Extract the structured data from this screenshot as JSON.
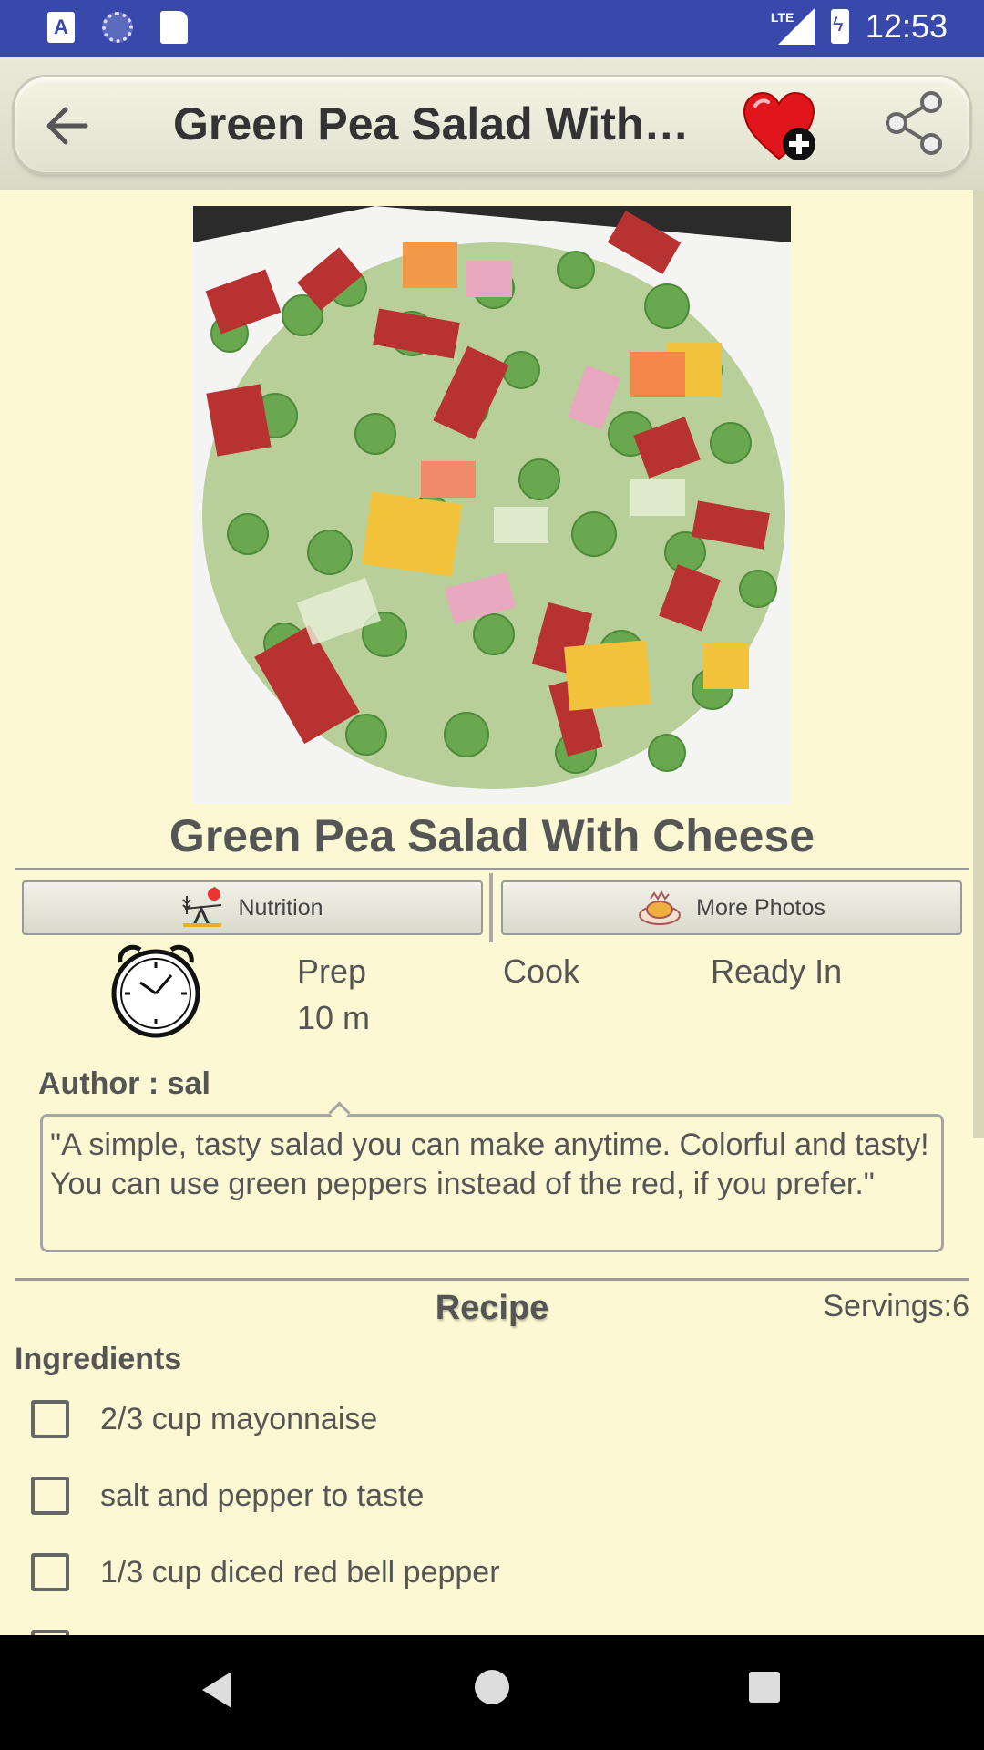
{
  "status_bar": {
    "left_icons": [
      "app-a-icon",
      "sync-icon",
      "sd-card-icon"
    ],
    "network": "LTE",
    "time": "12:53"
  },
  "toolbar": {
    "back_icon": "arrow-left-icon",
    "title": "Green Pea Salad With…",
    "favorite_icon": "heart-plus-icon",
    "share_icon": "share-icon"
  },
  "recipe": {
    "name": "Green Pea Salad With Cheese",
    "buttons": {
      "nutrition": "Nutrition",
      "more_photos": "More Photos"
    },
    "times": {
      "prep_label": "Prep",
      "prep_value": "10 m",
      "cook_label": "Cook",
      "ready_label": "Ready In"
    },
    "author": "Author : sal",
    "description": "\"A simple, tasty salad you can make anytime.  Colorful and tasty!  You can use green peppers instead of the red, if you prefer.\"",
    "section_heading": "Recipe",
    "servings": "Servings:6",
    "ingredients_heading": "Ingredients",
    "ingredients": [
      "2/3 cup mayonnaise",
      "salt and pepper to taste",
      "1/3 cup diced red bell pepper"
    ]
  },
  "colors": {
    "status_bar": "#3949ab",
    "background": "#fbf8d3",
    "heart": "#e0161c"
  }
}
